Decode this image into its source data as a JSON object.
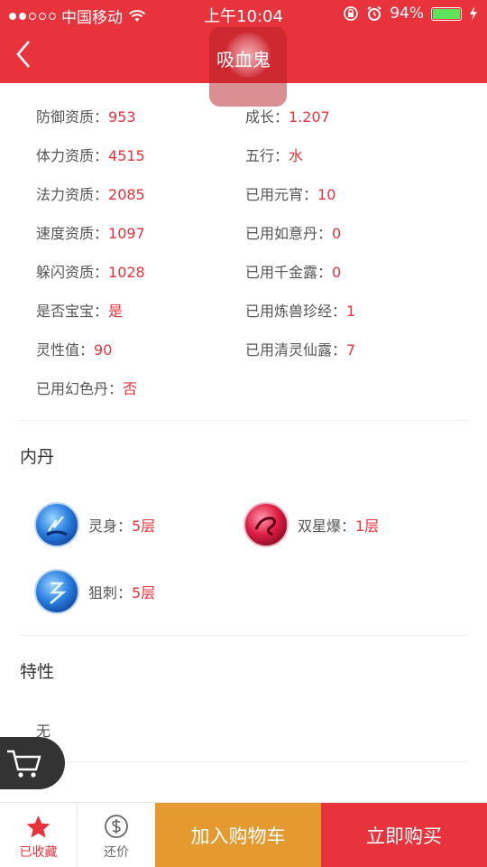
{
  "status_bar": {
    "carrier": "中国移动",
    "time": "上午10:04",
    "battery": "94%",
    "battery_level": 0.94
  },
  "header": {
    "title": "吸血鬼"
  },
  "attributes": [
    {
      "label": "防御资质：",
      "value": "953"
    },
    {
      "label": "成长：",
      "value": "1.207"
    },
    {
      "label": "体力资质：",
      "value": "4515"
    },
    {
      "label": "五行：",
      "value": "水"
    },
    {
      "label": "法力资质：",
      "value": "2085"
    },
    {
      "label": "已用元宵：",
      "value": "10"
    },
    {
      "label": "速度资质：",
      "value": "1097"
    },
    {
      "label": "已用如意丹：",
      "value": "0"
    },
    {
      "label": "躲闪资质：",
      "value": "1028"
    },
    {
      "label": "已用千金露：",
      "value": "0"
    },
    {
      "label": "是否宝宝：",
      "value": "是"
    },
    {
      "label": "已用炼兽珍经：",
      "value": "1"
    },
    {
      "label": "灵性值：",
      "value": "90"
    },
    {
      "label": "已用清灵仙露：",
      "value": "7"
    },
    {
      "label": "已用幻色丹：",
      "value": "否"
    }
  ],
  "neidan": {
    "title": "内丹",
    "items": [
      {
        "name": "灵身：",
        "level": "5层",
        "icon": "blue-orb-icon"
      },
      {
        "name": "双星爆：",
        "level": "1层",
        "icon": "red-orb-icon"
      },
      {
        "name": "狙刺：",
        "level": "5层",
        "icon": "blue-orb-icon"
      }
    ]
  },
  "traits": {
    "title": "特性",
    "value": "无"
  },
  "bottom_bar": {
    "favorite_label": "已收藏",
    "bargain_label": "还价",
    "add_cart_label": "加入购物车",
    "buy_now_label": "立即购买"
  },
  "colors": {
    "primary_red": "#e8323c",
    "orange": "#e49a2e"
  }
}
